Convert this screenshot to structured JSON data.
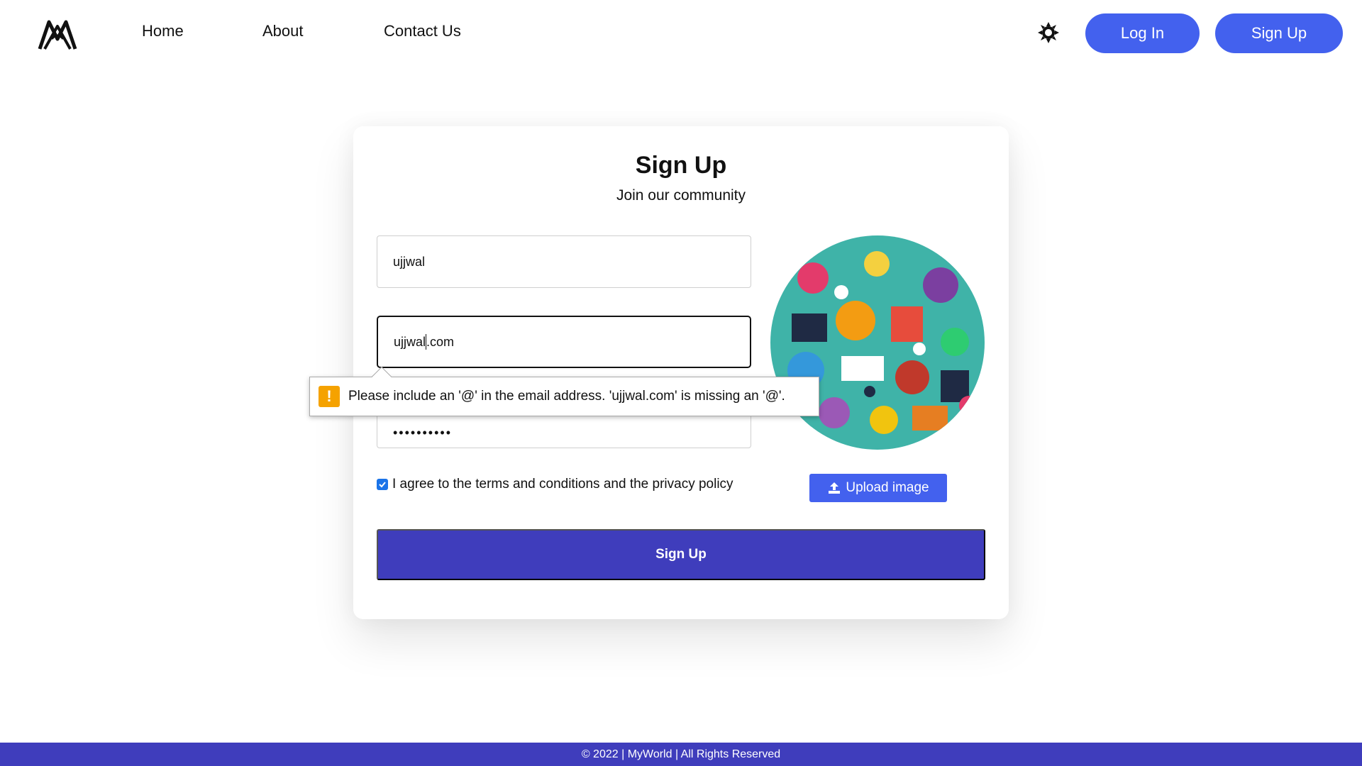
{
  "nav": {
    "logo_icon": "myworld-logo-icon",
    "home": "Home",
    "about": "About",
    "contact": "Contact Us",
    "theme_icon": "sun-icon",
    "login": "Log In",
    "signup": "Sign Up"
  },
  "form": {
    "title": "Sign Up",
    "subtitle": "Join our community",
    "name_value": "ujjwal",
    "email_value_before_caret": "ujjwal",
    "email_value_after_caret": ".com",
    "password_mask": "••••••••••",
    "agree_text": "I agree to the terms and conditions and the privacy policy",
    "agree_checked": true,
    "upload_label": "Upload image",
    "submit_label": "Sign Up"
  },
  "validation": {
    "message": "Please include an '@' in the email address. 'ujjwal.com' is missing an '@'.",
    "icon": "!"
  },
  "footer": {
    "text": "© 2022 | MyWorld | All Rights Reserved"
  },
  "colors": {
    "accent": "#4361ee",
    "primary_dark": "#3f3dbc",
    "warning": "#f5a200"
  }
}
